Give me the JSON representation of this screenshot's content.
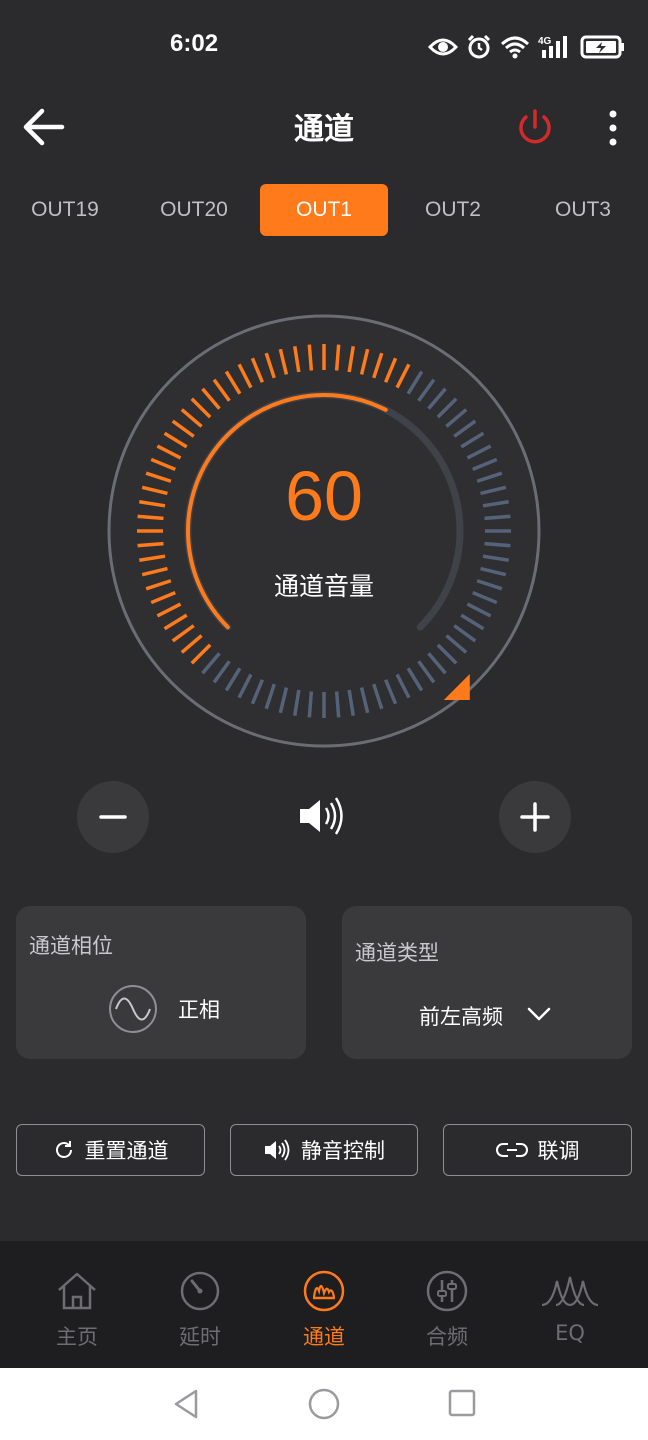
{
  "status": {
    "time": "6:02"
  },
  "header": {
    "title": "通道",
    "back_icon": "arrow-left-icon",
    "power_icon": "power-icon",
    "more_icon": "more-vertical-icon",
    "power_color": "#d42a2a"
  },
  "tabs": [
    {
      "label": "OUT19",
      "active": false
    },
    {
      "label": "OUT20",
      "active": false
    },
    {
      "label": "OUT1",
      "active": true
    },
    {
      "label": "OUT2",
      "active": false
    },
    {
      "label": "OUT3",
      "active": false
    }
  ],
  "volume": {
    "value": "60",
    "label": "通道音量",
    "level_fraction": 0.6
  },
  "phase_card": {
    "title": "通道相位",
    "value": "正相"
  },
  "type_card": {
    "title": "通道类型",
    "value": "前左高频"
  },
  "actions": {
    "reset": "重置通道",
    "mute": "静音控制",
    "link": "联调"
  },
  "bottom_nav": [
    {
      "label": "主页",
      "icon": "home-icon",
      "active": false
    },
    {
      "label": "延时",
      "icon": "timer-icon",
      "active": false
    },
    {
      "label": "通道",
      "icon": "channel-icon",
      "active": true
    },
    {
      "label": "合频",
      "icon": "mixer-icon",
      "active": false
    },
    {
      "label": "EQ",
      "icon": "eq-wave-icon",
      "active": false
    }
  ],
  "colors": {
    "accent": "#ff7a1a",
    "background": "#2b2b2d",
    "card": "#3a3a3d"
  }
}
